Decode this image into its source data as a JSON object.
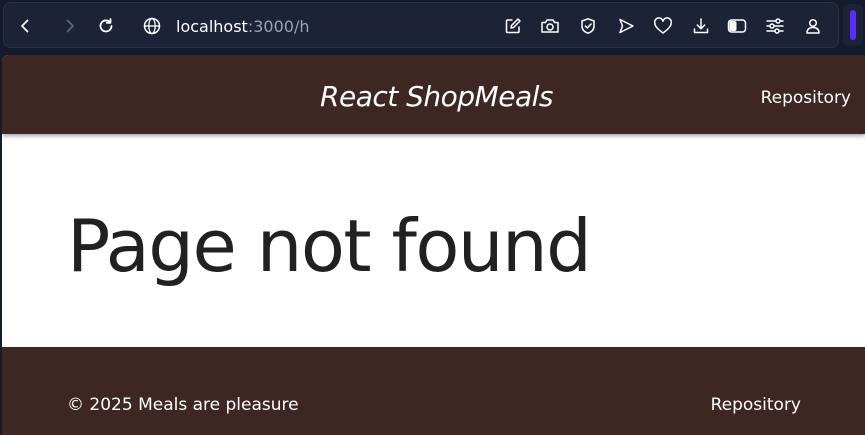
{
  "browser": {
    "url_host": "localhost",
    "url_rest": ":3000/h",
    "icons": [
      "back-icon",
      "forward-icon",
      "reload-icon",
      "globe-icon",
      "edit-icon",
      "camera-icon",
      "shield-icon",
      "send-icon",
      "heart-icon",
      "download-icon",
      "sidebar-icon",
      "sliders-icon",
      "profile-icon"
    ],
    "accent": "#5b2cff"
  },
  "header": {
    "brand": "React ShopMeals",
    "repository_link": "Repository"
  },
  "main": {
    "heading": "Page not found"
  },
  "footer": {
    "copyright": "© 2025 Meals are pleasure",
    "repository_link": "Repository"
  },
  "colors": {
    "brand_brown": "#3e2723",
    "page_background": "#ffffff",
    "heading_text": "#212121"
  }
}
